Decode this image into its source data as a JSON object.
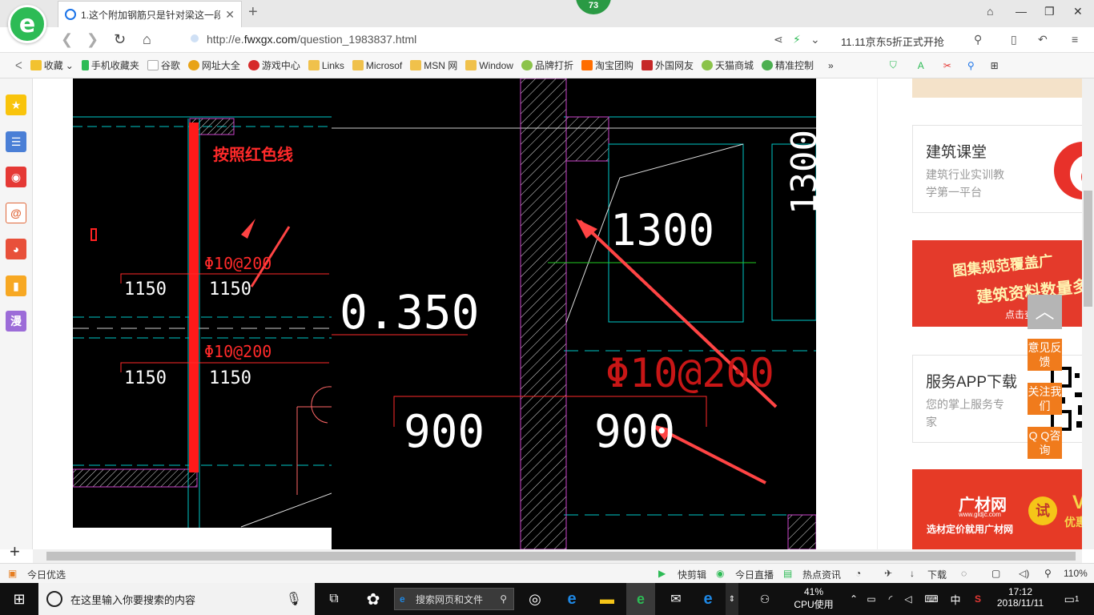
{
  "browser": {
    "logo_letter": "e",
    "tab_title": "1.这个附加钢筋只是针对梁这一段",
    "badge_count": "73",
    "url_prefix": "http://e.",
    "url_domain": "fwxgx.com",
    "url_path": "/question_1983837.html",
    "promo_text": "11.11京东5折正式开抢"
  },
  "bookmarks": [
    {
      "label": "收藏",
      "icon": "star-icon"
    },
    {
      "label": "手机收藏夹",
      "icon": "phone-icon"
    },
    {
      "label": "谷歌",
      "icon": "page-icon"
    },
    {
      "label": "网址大全",
      "icon": "globe-icon"
    },
    {
      "label": "游戏中心",
      "icon": "game-icon"
    },
    {
      "label": "Links",
      "icon": "folder-icon"
    },
    {
      "label": "Microsof",
      "icon": "folder-icon"
    },
    {
      "label": "MSN 网",
      "icon": "folder-icon"
    },
    {
      "label": "Window",
      "icon": "folder-icon"
    },
    {
      "label": "品牌打折",
      "icon": "leaf-icon"
    },
    {
      "label": "淘宝团购",
      "icon": "tao-icon"
    },
    {
      "label": "外国网友",
      "icon": "flag-icon"
    },
    {
      "label": "天猫商城",
      "icon": "leaf-icon"
    },
    {
      "label": "精准控制",
      "icon": "chat-icon"
    }
  ],
  "sidebar_left": {
    "comic_label": "漫"
  },
  "cad_left": {
    "annotation": "按照红色线",
    "rebar1": "Φ10@200",
    "rebar2": "Φ10@200",
    "dim_a1": "1150",
    "dim_b1": "1150",
    "dim_a2": "1150",
    "dim_b2": "1150"
  },
  "cad_right": {
    "elev": "0.350",
    "dim_1300a": "1300",
    "dim_1300b": "1300",
    "rebar": "Φ10@200",
    "dim_900a": "900",
    "dim_900b": "900"
  },
  "right_ads": {
    "card1_title": "建筑课堂",
    "card1_desc1": "建筑行业实训教",
    "card1_desc2": "学第一平台",
    "banner1_line1": "图集规范覆盖广",
    "banner1_line2": "建筑资料数量多",
    "banner1_cta": "点击查看",
    "card2_title": "服务APP下载",
    "card2_desc1": "您的掌上服务专",
    "card2_desc2": "家",
    "banner2_brand": "广材网",
    "banner2_url": "www.gldjc.com",
    "banner2_slogan": "选材定价就用广材网",
    "banner2_try": "试",
    "banner2_vip": "VIP",
    "banner2_vip_sub": "优惠试用"
  },
  "floating": {
    "feedback": "意见反馈",
    "follow": "关注我们",
    "qq": "Q Q咨询"
  },
  "statusbar": {
    "today_pick": "今日优选",
    "quick_cut": "快剪辑",
    "live": "今日直播",
    "news": "热点资讯",
    "download": "下载",
    "zoom": "110%"
  },
  "taskbar": {
    "search_placeholder": "在这里输入你要搜索的内容",
    "web_search": "搜索网页和文件",
    "cpu_percent": "41%",
    "cpu_label": "CPU使用",
    "ime": "中",
    "time": "17:12",
    "date": "2018/11/11",
    "notifications": "1"
  }
}
